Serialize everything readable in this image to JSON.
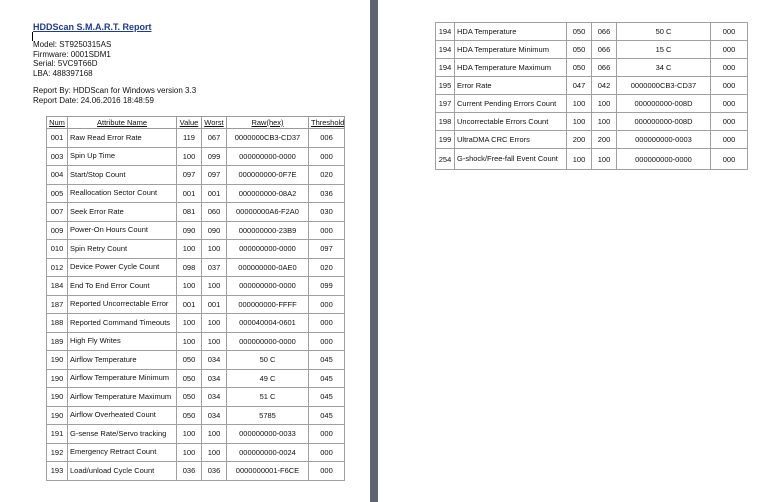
{
  "report": {
    "title": "HDDScan S.M.A.R.T. Report",
    "model": "Model: ST9250315AS",
    "firmware": "Firmware: 0001SDM1",
    "serial": "Serial: 5VC9T66D",
    "lba": "LBA: 488397168",
    "report_by": "Report By: HDDScan for Windows version 3.3",
    "report_date": "Report Date: 24.06.2016   18:48:59"
  },
  "table": {
    "headers": [
      "Num",
      "Attribute Name",
      "Value",
      "Worst",
      "Raw(hex)",
      "Threshold"
    ],
    "left_rows": [
      [
        "001",
        "Raw Read Error Rate",
        "119",
        "067",
        "0000000CB3-CD37",
        "006"
      ],
      [
        "003",
        "Spin Up Time",
        "100",
        "099",
        "000000000-0000",
        "000"
      ],
      [
        "004",
        "Start/Stop Count",
        "097",
        "097",
        "000000000-0F7E",
        "020"
      ],
      [
        "005",
        "Reallocation Sector Count",
        "001",
        "001",
        "000000000-08A2",
        "036"
      ],
      [
        "007",
        "Seek Error Rate",
        "081",
        "060",
        "00000000A6-F2A0",
        "030"
      ],
      [
        "009",
        "Power-On Hours Count",
        "090",
        "090",
        "000000000-23B9",
        "000"
      ],
      [
        "010",
        "Spin Retry Count",
        "100",
        "100",
        "000000000-0000",
        "097"
      ],
      [
        "012",
        "Device Power Cycle Count",
        "098",
        "037",
        "000000000-0AE0",
        "020"
      ],
      [
        "184",
        "End To End Error Count",
        "100",
        "100",
        "000000000-0000",
        "099"
      ],
      [
        "187",
        "Reported Uncorrectable Error",
        "001",
        "001",
        "000000000-FFFF",
        "000"
      ],
      [
        "188",
        "Reported Command Timeouts",
        "100",
        "100",
        "000040004-0601",
        "000"
      ],
      [
        "189",
        "High Fly Writes",
        "100",
        "100",
        "000000000-0000",
        "000"
      ],
      [
        "190",
        "Airflow Temperature",
        "050",
        "034",
        "50 C",
        "045"
      ],
      [
        "190",
        "Airflow Temperature Minimum",
        "050",
        "034",
        "49 C",
        "045"
      ],
      [
        "190",
        "Airflow Temperature Maximum",
        "050",
        "034",
        "51 C",
        "045"
      ],
      [
        "190",
        "Airflow Overheated Count",
        "050",
        "034",
        "5785",
        "045"
      ],
      [
        "191",
        "G-sense Rate/Servo tracking",
        "100",
        "100",
        "000000000-0033",
        "000"
      ],
      [
        "192",
        "Emergency Retract Count",
        "100",
        "100",
        "000000000-0024",
        "000"
      ],
      [
        "193",
        "Load/unload Cycle Count",
        "036",
        "036",
        "0000000001-F6CE",
        "000"
      ]
    ],
    "right_rows": [
      [
        "194",
        "HDA Temperature",
        "050",
        "066",
        "50 C",
        "000"
      ],
      [
        "194",
        "HDA Temperature Minimum",
        "050",
        "066",
        "15 C",
        "000"
      ],
      [
        "194",
        "HDA Temperature Maximum",
        "050",
        "066",
        "34 C",
        "000"
      ],
      [
        "195",
        "Error Rate",
        "047",
        "042",
        "0000000CB3-CD37",
        "000"
      ],
      [
        "197",
        "Current Pending Errors Count",
        "100",
        "100",
        "000000000-008D",
        "000"
      ],
      [
        "198",
        "Uncorrectable Errors Count",
        "100",
        "100",
        "000000000-008D",
        "000"
      ],
      [
        "199",
        "UltraDMA CRC Errors",
        "200",
        "200",
        "000000000-0003",
        "000"
      ],
      [
        "254",
        "G-shock/Free-fall Event Count",
        "100",
        "100",
        "000000000-0000",
        "000"
      ]
    ]
  }
}
